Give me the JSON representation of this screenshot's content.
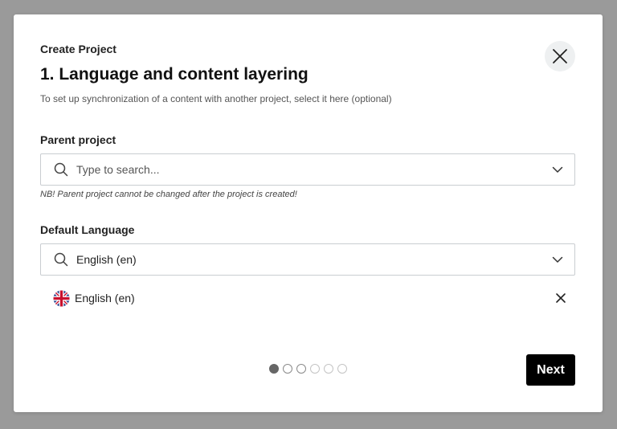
{
  "modal": {
    "overline": "Create Project",
    "title": "1. Language and content layering",
    "subtitle": "To set up synchronization of a content with another project, select it here (optional)"
  },
  "parent_project": {
    "label": "Parent project",
    "placeholder": "Type to search...",
    "note": "NB! Parent project cannot be changed after the project is created!"
  },
  "default_language": {
    "label": "Default Language",
    "value": "English (en)",
    "selected": [
      {
        "label": "English (en)",
        "flag_icon": "uk-flag-icon"
      }
    ]
  },
  "stepper": {
    "total_steps": 6,
    "current_step": 1
  },
  "footer": {
    "next_label": "Next"
  },
  "colors": {
    "overlay": "#9a9a9a",
    "primary_button": "#000000",
    "border": "#c9cdd1",
    "close_bg": "#eef0f1"
  }
}
